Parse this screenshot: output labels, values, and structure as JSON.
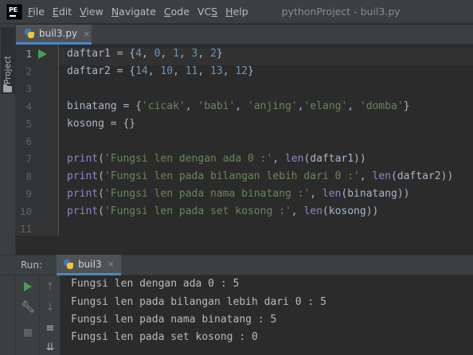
{
  "menubar": {
    "logo": "PE",
    "items": [
      {
        "label": "File",
        "mnemonic": "F"
      },
      {
        "label": "Edit",
        "mnemonic": "E"
      },
      {
        "label": "View",
        "mnemonic": "V"
      },
      {
        "label": "Navigate",
        "mnemonic": "N"
      },
      {
        "label": "Code",
        "mnemonic": "C"
      },
      {
        "label": "VCS",
        "mnemonic": "S"
      },
      {
        "label": "Help",
        "mnemonic": "H"
      }
    ],
    "window_title": "pythonProject - buil3.py"
  },
  "side_panel": {
    "project_label": "Project"
  },
  "editor": {
    "tab_label": "buil3.py",
    "close_glyph": "×",
    "line_numbers": [
      "1",
      "2",
      "3",
      "4",
      "5",
      "6",
      "7",
      "8",
      "9",
      "10",
      "11"
    ],
    "lines": [
      "daftar1 = {4, 0, 1, 3, 2}",
      "daftar2 = {14, 10, 11, 13, 12}",
      "",
      "binatang = {'cicak', 'babi', 'anjing','elang', 'domba'}",
      "kosong = {}",
      "",
      "print('Fungsi len dengan ada 0 :', len(daftar1))",
      "print('Fungsi len pada bilangan lebih dari 0 :', len(daftar2))",
      "print('Fungsi len pada nama binatang :', len(binatang))",
      "print('Fungsi len pada set kosong :', len(kosong))",
      ""
    ]
  },
  "run": {
    "label": "Run:",
    "tab_label": "buil3",
    "close_glyph": "×",
    "output": [
      "Fungsi len dengan ada 0 : 5",
      "Fungsi len pada bilangan lebih dari 0 : 5",
      "Fungsi len pada nama binatang : 5",
      "Fungsi len pada set kosong : 0"
    ]
  },
  "colors": {
    "background": "#2b2b2b",
    "keyword_number": "#6897bb",
    "string": "#6a8759",
    "builtin": "#8888c6",
    "run_green": "#499c54",
    "tab_accent": "#4a88c7"
  },
  "icons": [
    "app-logo-icon",
    "folder-icon",
    "python-file-icon",
    "run-arrow-icon",
    "play-icon",
    "wrench-icon",
    "stop-icon",
    "arrow-up-icon",
    "arrow-down-icon",
    "soft-wrap-icon",
    "sort-icon"
  ]
}
